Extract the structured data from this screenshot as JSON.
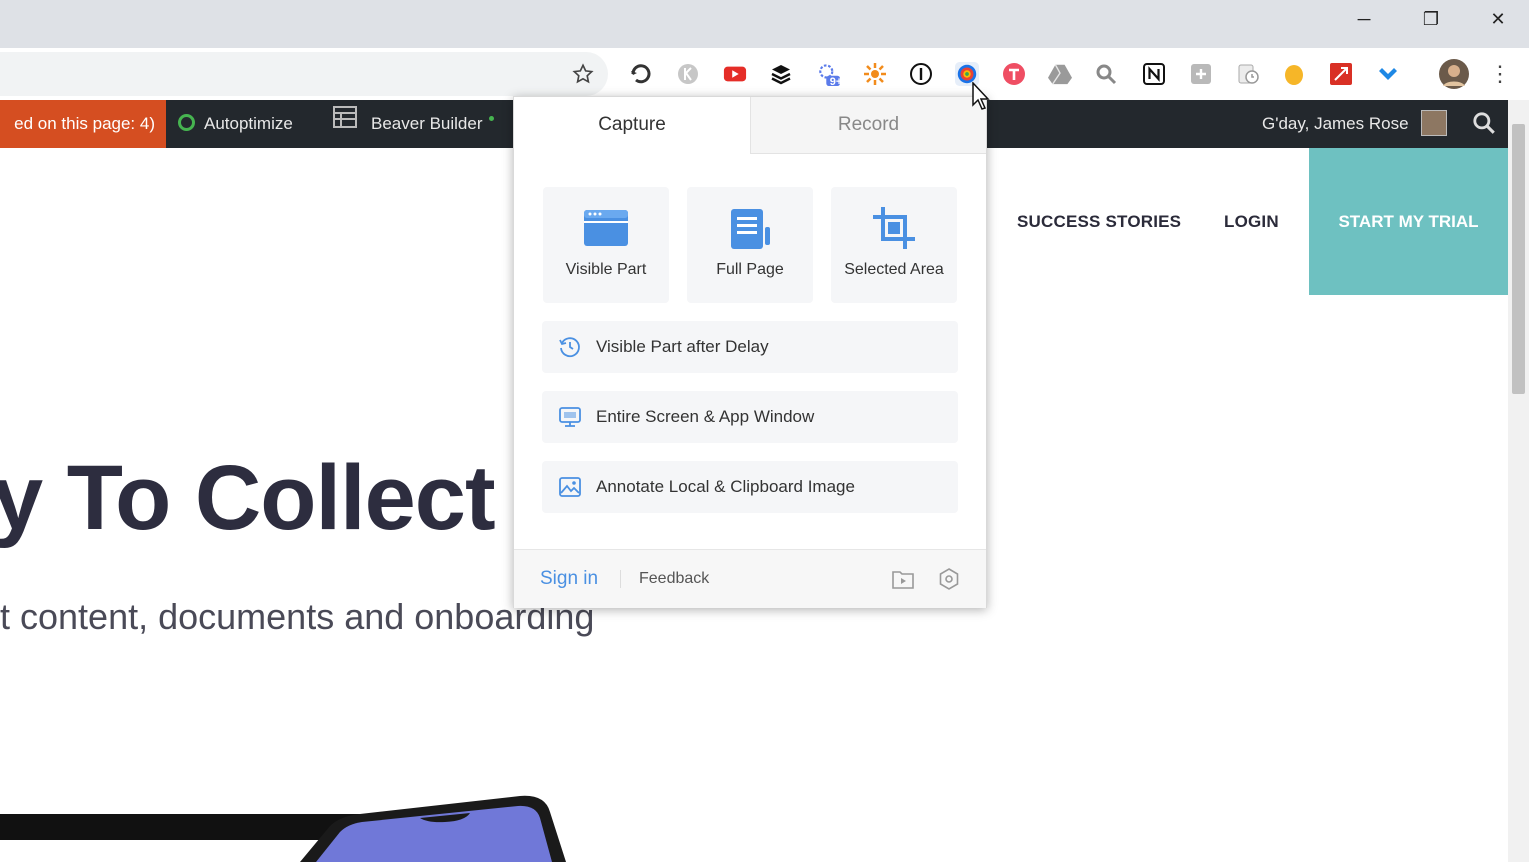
{
  "window": {
    "minimize_glyph": "─",
    "restore_glyph": "❐",
    "close_glyph": "✕"
  },
  "toolbar": {
    "extensions_badge": "9+",
    "menu_glyph": "⋮"
  },
  "adminbar": {
    "notice_text": "ed on this page: 4)",
    "autoptimize_label": "Autoptimize",
    "beaver_builder_label": "Beaver Builder",
    "greeting": "G'day, James Rose"
  },
  "site": {
    "nav": {
      "success_stories": "SUCCESS STORIES",
      "login": "LOGIN",
      "start_trial": "START MY TRIAL"
    },
    "hero_title": "y To Collect",
    "hero_subtitle": "t content, documents and onboarding"
  },
  "popup": {
    "tabs": {
      "capture": "Capture",
      "record": "Record"
    },
    "cards": {
      "visible_part": "Visible Part",
      "full_page": "Full Page",
      "selected_area": "Selected Area"
    },
    "rows": {
      "delay": "Visible Part after Delay",
      "entire_screen": "Entire Screen & App Window",
      "annotate": "Annotate Local & Clipboard Image"
    },
    "footer": {
      "sign_in": "Sign in",
      "feedback": "Feedback"
    }
  },
  "colors": {
    "accent_blue": "#4a90e2",
    "admin_bar": "#23282d",
    "admin_notice": "#d54e21",
    "cta_teal": "#6ec1c1",
    "autoptimize_green": "#46b450"
  }
}
